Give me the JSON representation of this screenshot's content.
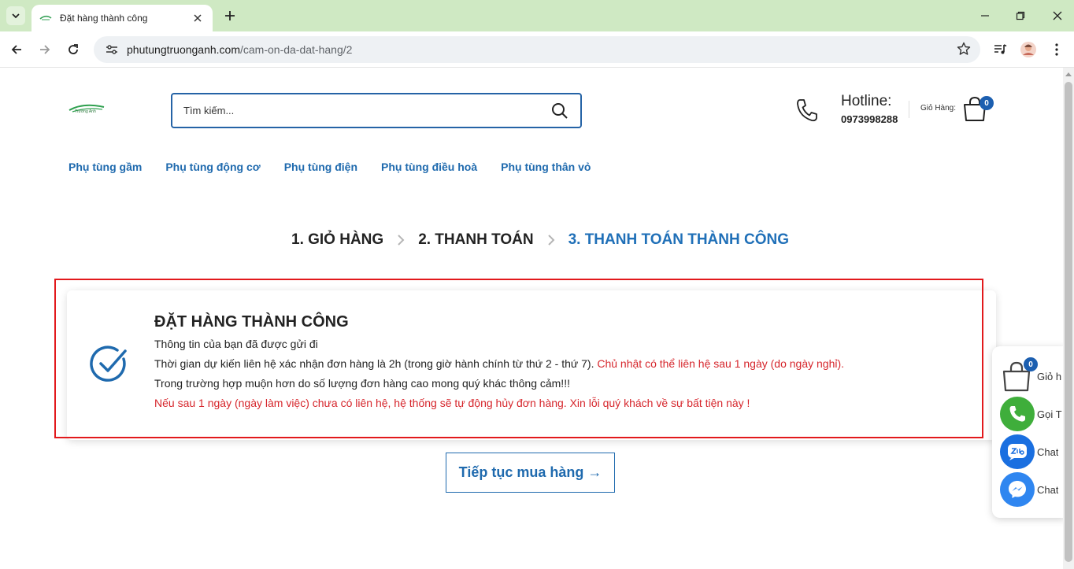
{
  "browser": {
    "tab_title": "Đặt hàng thành công",
    "url_host": "phutungtruonganh.com",
    "url_path": "/cam-on-da-dat-hang/2"
  },
  "header": {
    "logo_text": "Trường Anh",
    "search_placeholder": "Tìm kiếm...",
    "hotline_label": "Hotline:",
    "hotline_number": "0973998288",
    "cart_label": "Giỏ Hàng:",
    "cart_count": "0"
  },
  "nav": [
    {
      "label": "Phụ tùng gầm"
    },
    {
      "label": "Phụ tùng động cơ"
    },
    {
      "label": "Phụ tùng điện"
    },
    {
      "label": "Phụ tùng điều hoà"
    },
    {
      "label": "Phụ tùng thân vỏ"
    }
  ],
  "steps": [
    {
      "label": "1. GIỎ HÀNG"
    },
    {
      "label": "2. THANH TOÁN"
    },
    {
      "label": "3. THANH TOÁN THÀNH CÔNG"
    }
  ],
  "success": {
    "title": "ĐẶT HÀNG THÀNH CÔNG",
    "line1": "Thông tin của bạn đã được gửi đi",
    "line2_main": "Thời gian dự kiến liên hệ xác nhận đơn hàng là 2h (trong giờ hành chính từ thứ 2 - thứ 7).",
    "line2_red": " Chủ nhật có thể liên hệ sau 1 ngày (do ngày nghỉ).",
    "line3": "Trong trường hợp muộn hơn do số lượng đơn hàng cao mong quý khác thông cảm!!!",
    "line4_red": "Nếu sau 1 ngày (ngày làm việc) chưa có liên hệ, hệ thống sẽ tự động hủy đơn hàng. Xin lỗi quý khách về sự bất tiện này !"
  },
  "continue_button": "Tiếp tục mua hàng →",
  "float_panel": {
    "cart_count": "0",
    "items": [
      {
        "label": "Giỏ h"
      },
      {
        "label": "Gọi T"
      },
      {
        "label": "Chat"
      },
      {
        "label": "Chat"
      }
    ]
  },
  "colors": {
    "brand_blue": "#1f6aae",
    "alert_red": "#d6262c",
    "tab_bar": "#cfe9c3"
  }
}
